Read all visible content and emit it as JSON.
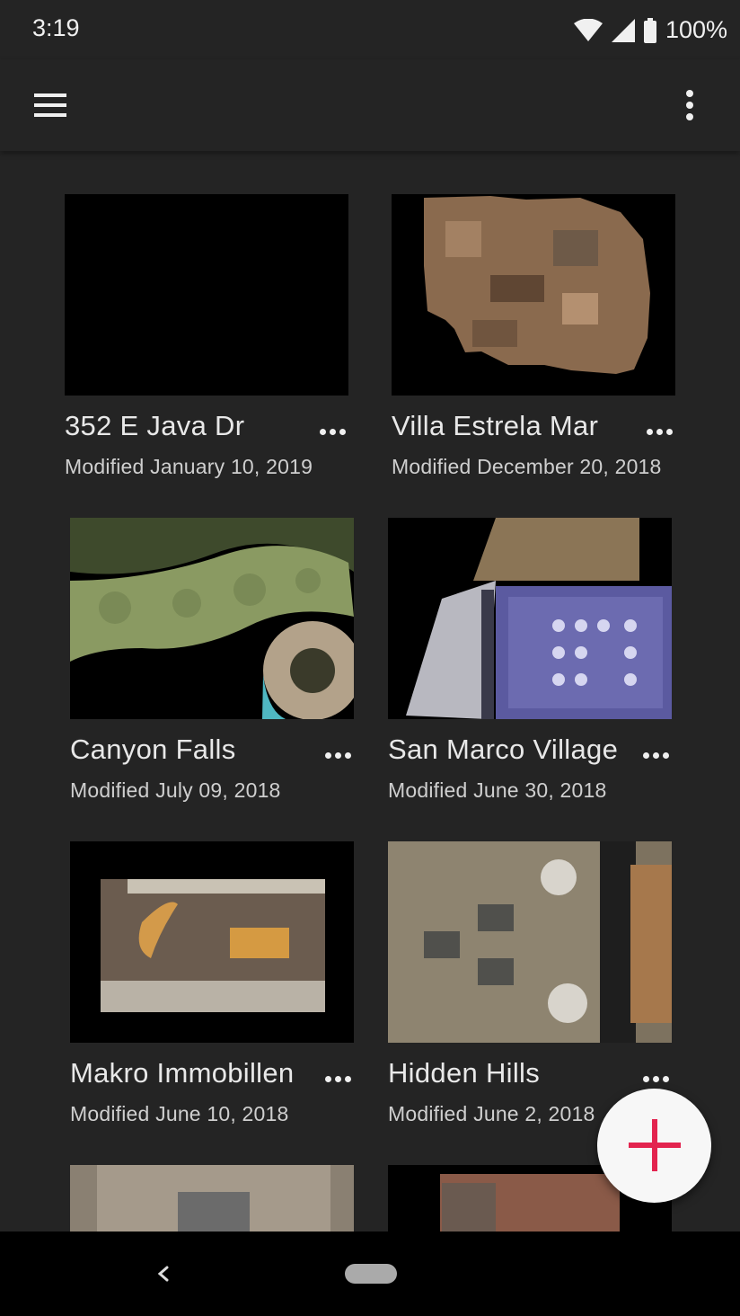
{
  "status_bar": {
    "time": "3:19",
    "battery": "100%"
  },
  "app_bar": {
    "menu_icon": "hamburger-menu-icon",
    "overflow_icon": "more-vert-icon"
  },
  "spaces": [
    {
      "title": "352 E Java Dr",
      "modified": "Modified January 10, 2019"
    },
    {
      "title": "Villa Estrela Mar",
      "modified": "Modified December 20, 2018"
    },
    {
      "title": "Canyon Falls",
      "modified": "Modified July 09, 2018"
    },
    {
      "title": "San Marco Village",
      "modified": "Modified June 30, 2018"
    },
    {
      "title": "Makro Immobillen",
      "modified": "Modified June 10, 2018"
    },
    {
      "title": "Hidden Hills",
      "modified": "Modified June 2, 2018"
    }
  ],
  "fab": {
    "icon": "plus-icon",
    "color": "#e3244f"
  },
  "nav_bar": {
    "back_icon": "back-chevron-icon",
    "home_icon": "home-pill-icon"
  }
}
